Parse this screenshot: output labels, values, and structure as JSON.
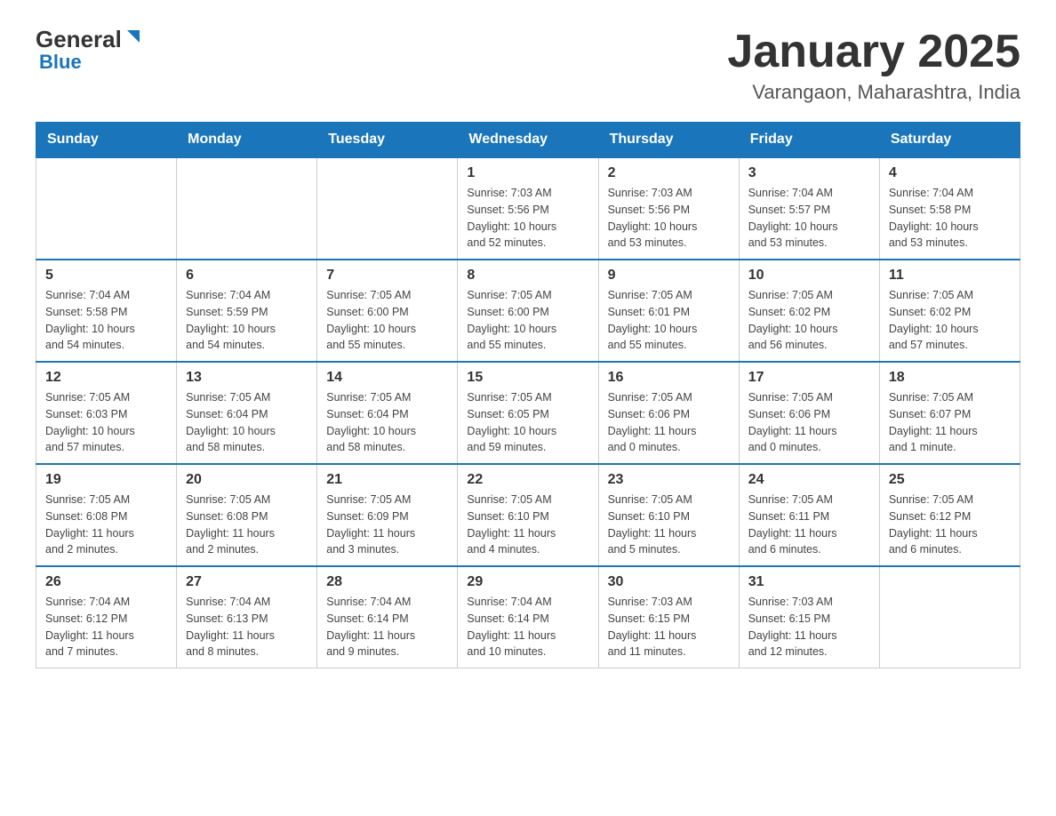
{
  "header": {
    "logo_general": "General",
    "logo_blue": "Blue",
    "title": "January 2025",
    "location": "Varangaon, Maharashtra, India"
  },
  "days_of_week": [
    "Sunday",
    "Monday",
    "Tuesday",
    "Wednesday",
    "Thursday",
    "Friday",
    "Saturday"
  ],
  "weeks": [
    {
      "days": [
        {
          "number": "",
          "info": ""
        },
        {
          "number": "",
          "info": ""
        },
        {
          "number": "",
          "info": ""
        },
        {
          "number": "1",
          "info": "Sunrise: 7:03 AM\nSunset: 5:56 PM\nDaylight: 10 hours\nand 52 minutes."
        },
        {
          "number": "2",
          "info": "Sunrise: 7:03 AM\nSunset: 5:56 PM\nDaylight: 10 hours\nand 53 minutes."
        },
        {
          "number": "3",
          "info": "Sunrise: 7:04 AM\nSunset: 5:57 PM\nDaylight: 10 hours\nand 53 minutes."
        },
        {
          "number": "4",
          "info": "Sunrise: 7:04 AM\nSunset: 5:58 PM\nDaylight: 10 hours\nand 53 minutes."
        }
      ]
    },
    {
      "days": [
        {
          "number": "5",
          "info": "Sunrise: 7:04 AM\nSunset: 5:58 PM\nDaylight: 10 hours\nand 54 minutes."
        },
        {
          "number": "6",
          "info": "Sunrise: 7:04 AM\nSunset: 5:59 PM\nDaylight: 10 hours\nand 54 minutes."
        },
        {
          "number": "7",
          "info": "Sunrise: 7:05 AM\nSunset: 6:00 PM\nDaylight: 10 hours\nand 55 minutes."
        },
        {
          "number": "8",
          "info": "Sunrise: 7:05 AM\nSunset: 6:00 PM\nDaylight: 10 hours\nand 55 minutes."
        },
        {
          "number": "9",
          "info": "Sunrise: 7:05 AM\nSunset: 6:01 PM\nDaylight: 10 hours\nand 55 minutes."
        },
        {
          "number": "10",
          "info": "Sunrise: 7:05 AM\nSunset: 6:02 PM\nDaylight: 10 hours\nand 56 minutes."
        },
        {
          "number": "11",
          "info": "Sunrise: 7:05 AM\nSunset: 6:02 PM\nDaylight: 10 hours\nand 57 minutes."
        }
      ]
    },
    {
      "days": [
        {
          "number": "12",
          "info": "Sunrise: 7:05 AM\nSunset: 6:03 PM\nDaylight: 10 hours\nand 57 minutes."
        },
        {
          "number": "13",
          "info": "Sunrise: 7:05 AM\nSunset: 6:04 PM\nDaylight: 10 hours\nand 58 minutes."
        },
        {
          "number": "14",
          "info": "Sunrise: 7:05 AM\nSunset: 6:04 PM\nDaylight: 10 hours\nand 58 minutes."
        },
        {
          "number": "15",
          "info": "Sunrise: 7:05 AM\nSunset: 6:05 PM\nDaylight: 10 hours\nand 59 minutes."
        },
        {
          "number": "16",
          "info": "Sunrise: 7:05 AM\nSunset: 6:06 PM\nDaylight: 11 hours\nand 0 minutes."
        },
        {
          "number": "17",
          "info": "Sunrise: 7:05 AM\nSunset: 6:06 PM\nDaylight: 11 hours\nand 0 minutes."
        },
        {
          "number": "18",
          "info": "Sunrise: 7:05 AM\nSunset: 6:07 PM\nDaylight: 11 hours\nand 1 minute."
        }
      ]
    },
    {
      "days": [
        {
          "number": "19",
          "info": "Sunrise: 7:05 AM\nSunset: 6:08 PM\nDaylight: 11 hours\nand 2 minutes."
        },
        {
          "number": "20",
          "info": "Sunrise: 7:05 AM\nSunset: 6:08 PM\nDaylight: 11 hours\nand 2 minutes."
        },
        {
          "number": "21",
          "info": "Sunrise: 7:05 AM\nSunset: 6:09 PM\nDaylight: 11 hours\nand 3 minutes."
        },
        {
          "number": "22",
          "info": "Sunrise: 7:05 AM\nSunset: 6:10 PM\nDaylight: 11 hours\nand 4 minutes."
        },
        {
          "number": "23",
          "info": "Sunrise: 7:05 AM\nSunset: 6:10 PM\nDaylight: 11 hours\nand 5 minutes."
        },
        {
          "number": "24",
          "info": "Sunrise: 7:05 AM\nSunset: 6:11 PM\nDaylight: 11 hours\nand 6 minutes."
        },
        {
          "number": "25",
          "info": "Sunrise: 7:05 AM\nSunset: 6:12 PM\nDaylight: 11 hours\nand 6 minutes."
        }
      ]
    },
    {
      "days": [
        {
          "number": "26",
          "info": "Sunrise: 7:04 AM\nSunset: 6:12 PM\nDaylight: 11 hours\nand 7 minutes."
        },
        {
          "number": "27",
          "info": "Sunrise: 7:04 AM\nSunset: 6:13 PM\nDaylight: 11 hours\nand 8 minutes."
        },
        {
          "number": "28",
          "info": "Sunrise: 7:04 AM\nSunset: 6:14 PM\nDaylight: 11 hours\nand 9 minutes."
        },
        {
          "number": "29",
          "info": "Sunrise: 7:04 AM\nSunset: 6:14 PM\nDaylight: 11 hours\nand 10 minutes."
        },
        {
          "number": "30",
          "info": "Sunrise: 7:03 AM\nSunset: 6:15 PM\nDaylight: 11 hours\nand 11 minutes."
        },
        {
          "number": "31",
          "info": "Sunrise: 7:03 AM\nSunset: 6:15 PM\nDaylight: 11 hours\nand 12 minutes."
        },
        {
          "number": "",
          "info": ""
        }
      ]
    }
  ]
}
